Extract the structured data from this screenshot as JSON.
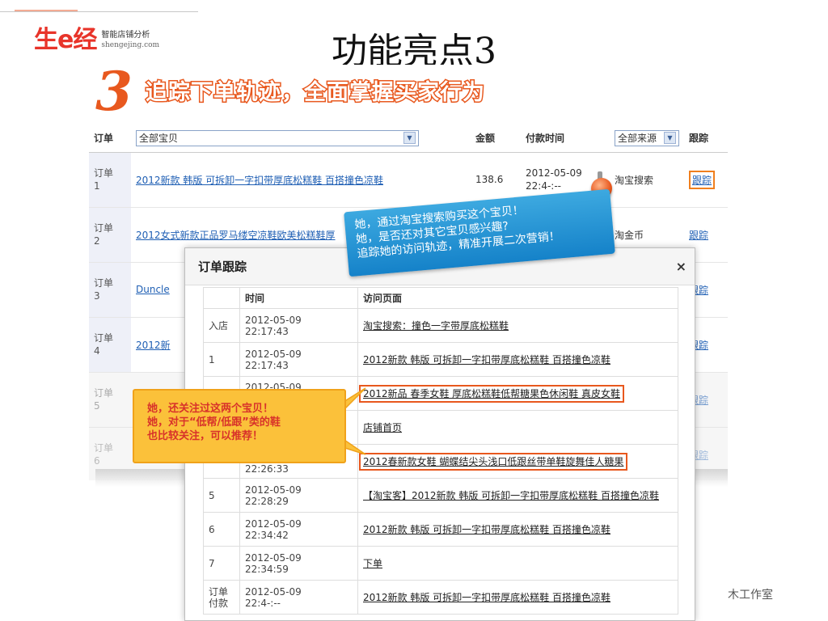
{
  "logo": {
    "mark": "生e经",
    "line1": "智能店铺分析",
    "line2": "shengejing.com"
  },
  "slide_title": "功能亮点3",
  "step_number": "3",
  "headline": "追踪下单轨迹，全面掌握买家行为",
  "orders_table": {
    "headers": {
      "order": "订单",
      "goods_select": "全部宝贝",
      "amount": "金额",
      "pay_time": "付款时间",
      "source_select": "全部来源",
      "track": "跟踪"
    },
    "rows": [
      {
        "id": "订单\n1",
        "item": "2012新款 韩版 可拆卸一字扣带厚底松糕鞋 百搭撞色凉鞋",
        "amount": "138.6",
        "time": "2012-05-09\n22:4-:--",
        "source": "淘宝搜索",
        "track": "跟踪"
      },
      {
        "id": "订单\n2",
        "item": "2012女式新款正品罗马缕空凉鞋欧美松糕鞋厚",
        "amount": "",
        "time": "",
        "source": "淘金币",
        "track": "跟踪"
      },
      {
        "id": "订单\n3",
        "item": "Duncle",
        "amount": "",
        "time": "",
        "source": "",
        "track": "跟踪"
      },
      {
        "id": "订单\n4",
        "item": "2012新",
        "amount": "",
        "time": "",
        "source": "",
        "track": "跟踪"
      },
      {
        "id": "订单\n5",
        "item": "",
        "amount": "",
        "time": "",
        "source": "",
        "track": "跟踪"
      },
      {
        "id": "订单\n6",
        "item": "",
        "amount": "",
        "time": "",
        "source": "",
        "track": "跟踪"
      }
    ]
  },
  "popup": {
    "title": "订单跟踪",
    "close": "×",
    "headers": {
      "col0": "",
      "time": "时间",
      "page": "访问页面"
    },
    "rows": [
      {
        "step": "入店",
        "time": "2012-05-09\n22:17:43",
        "page": "淘宝搜索：撞色一字带厚底松糕鞋",
        "highlight": false
      },
      {
        "step": "1",
        "time": "2012-05-09\n22:17:43",
        "page": "2012新款 韩版 可拆卸一字扣带厚底松糕鞋 百搭撞色凉鞋",
        "highlight": false
      },
      {
        "step": "",
        "time": "2012-05-09",
        "page": "2012新品 春季女鞋 厚底松糕鞋低帮糖果色休闲鞋 真皮女鞋",
        "highlight": true
      },
      {
        "step": "",
        "time": "",
        "page": "店铺首页",
        "highlight": false
      },
      {
        "step": "",
        "time": "22:26:33",
        "page": "2012春新款女鞋 蝴蝶结尖头浅口低跟丝带单鞋旋舞佳人糖果",
        "highlight": true
      },
      {
        "step": "5",
        "time": "2012-05-09\n22:28:29",
        "page": "【淘宝客】2012新款 韩版 可拆卸一字扣带厚底松糕鞋 百搭撞色凉鞋",
        "highlight": false
      },
      {
        "step": "6",
        "time": "2012-05-09\n22:34:42",
        "page": "2012新款 韩版 可拆卸一字扣带厚底松糕鞋 百搭撞色凉鞋",
        "highlight": false
      },
      {
        "step": "7",
        "time": "2012-05-09\n22:34:59",
        "page": "下单",
        "highlight": false
      },
      {
        "step": "订单付款",
        "time": "2012-05-09\n22:4-:--",
        "page": "2012新款 韩版 可拆卸一字扣带厚底松糕鞋 百搭撞色凉鞋",
        "highlight": false
      }
    ]
  },
  "callout_blue": {
    "line1": "她，通过淘宝搜索购买这个宝贝！",
    "line2": "她，是否还对其它宝贝感兴趣?",
    "line3": "追踪她的访问轨迹，精准开展二次营销！"
  },
  "callout_orange": {
    "line1": "她，还关注过这两个宝贝！",
    "line2": "她，对于“低帮/低跟”类的鞋",
    "line3": "也比较关注，可以推荐！"
  },
  "watermark": "木工作室",
  "colors": {
    "accent_orange": "#e8581e",
    "link_blue": "#1f5fb4",
    "callout_blue": "#1582c9",
    "callout_yellow": "#fbc13a"
  }
}
